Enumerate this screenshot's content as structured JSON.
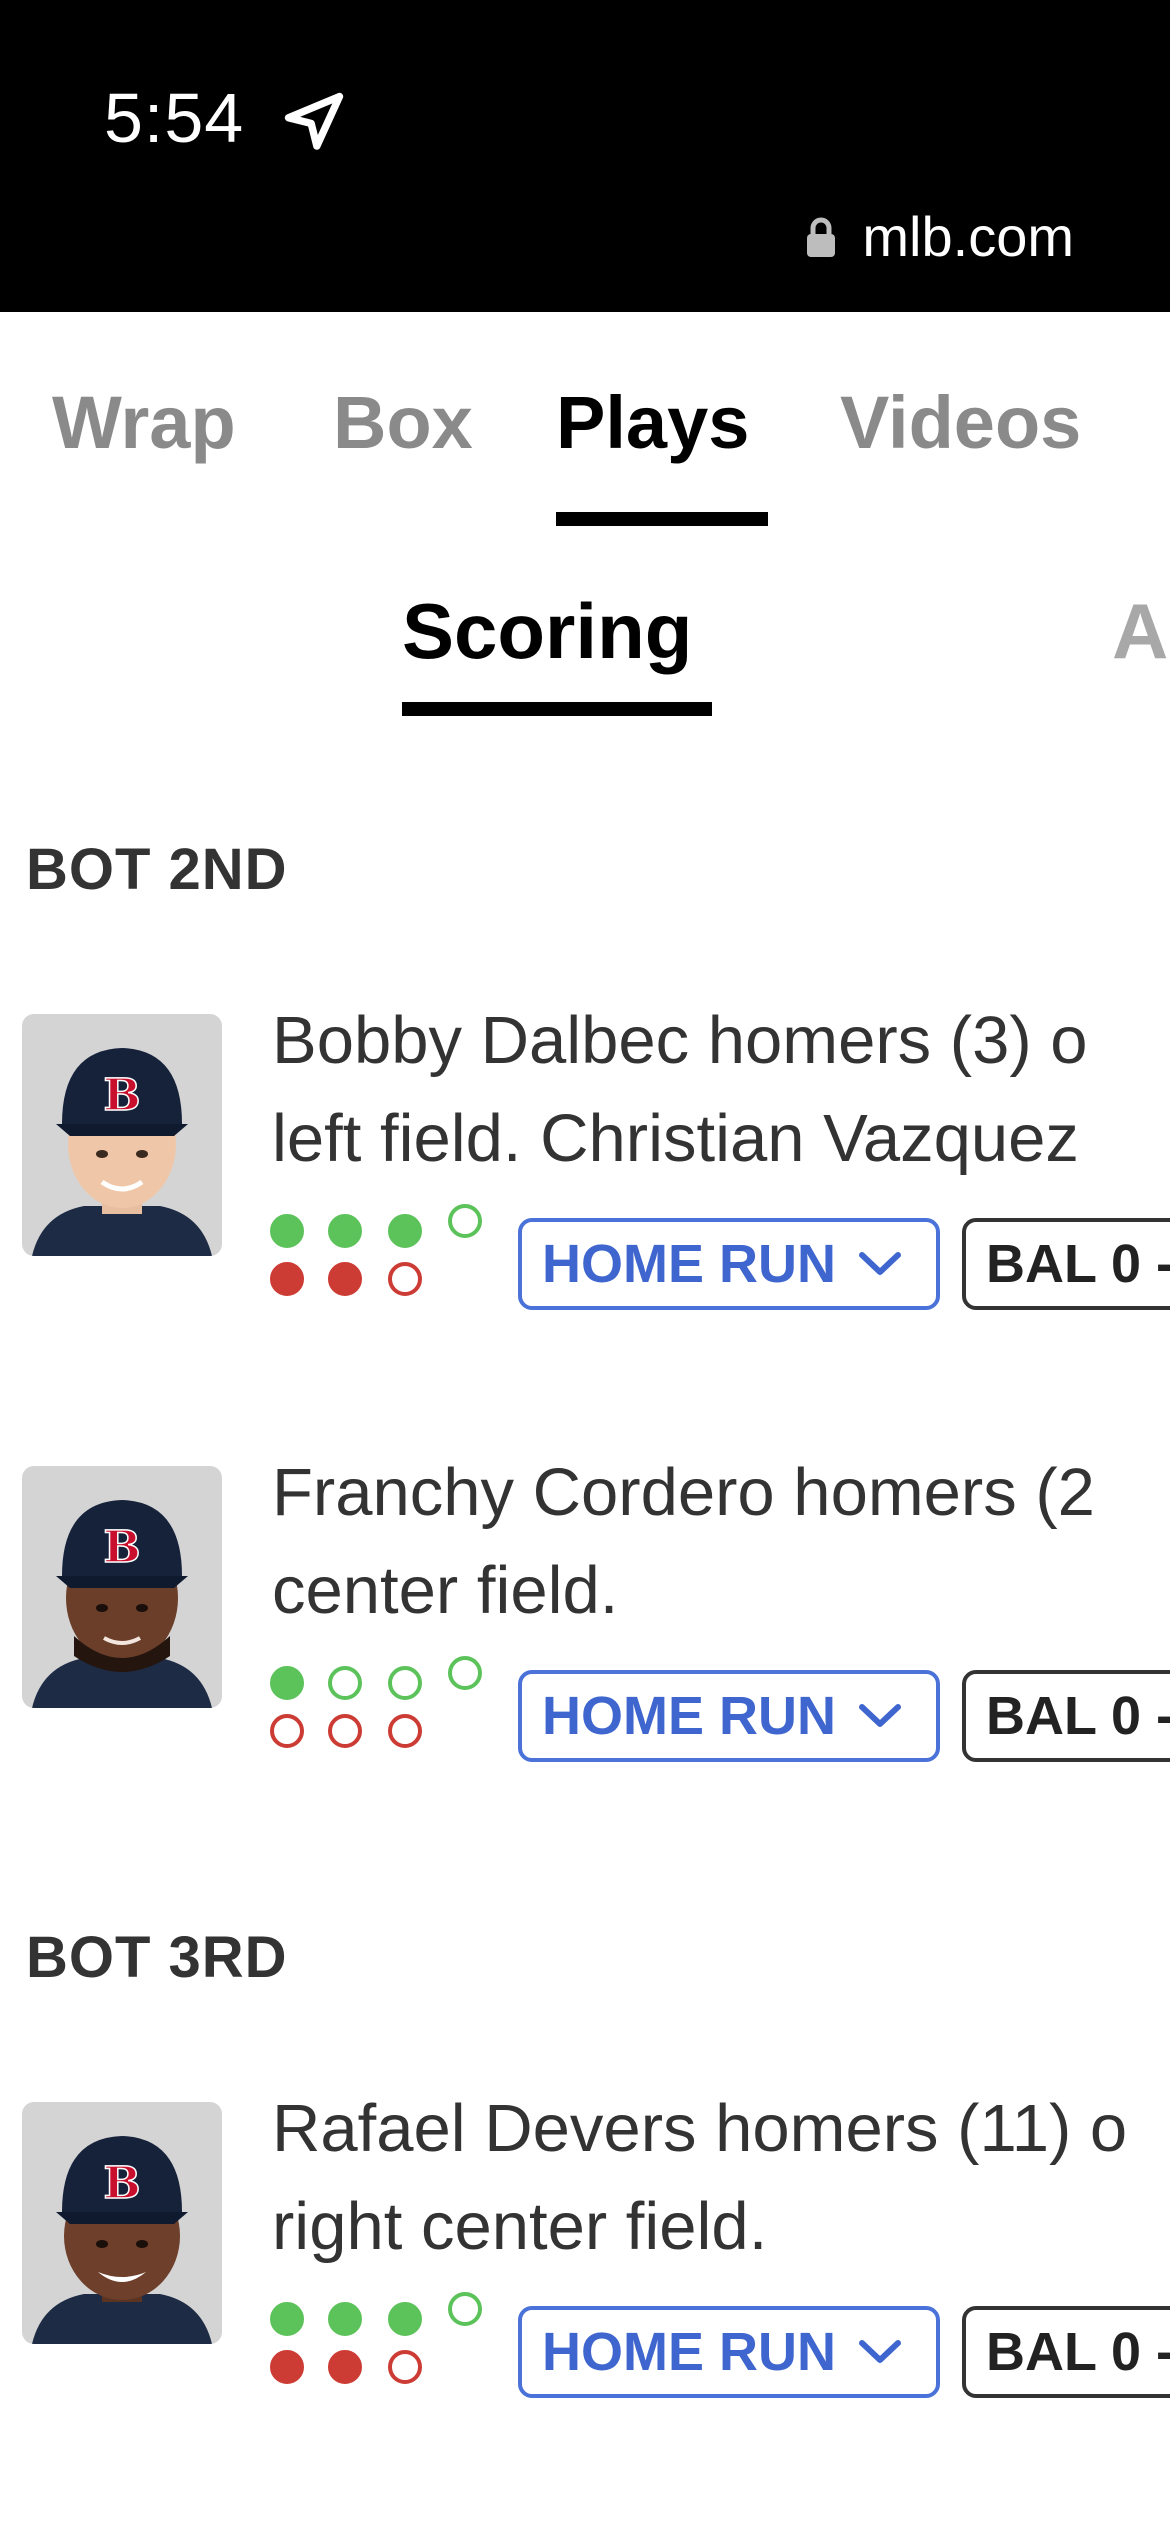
{
  "status_bar": {
    "time": "5:54",
    "url": "mlb.com"
  },
  "tabs": [
    {
      "label": "Wrap"
    },
    {
      "label": "Box"
    },
    {
      "label": "Plays"
    },
    {
      "label": "Videos"
    }
  ],
  "subtabs": [
    {
      "label": "Scoring"
    },
    {
      "label": "A"
    }
  ],
  "innings": [
    {
      "label": "BOT 2ND"
    },
    {
      "label": "BOT 3RD"
    }
  ],
  "plays": [
    {
      "line1": "Bobby Dalbec homers (3) o",
      "line2": "left field. Christian Vazquez",
      "play_type": "HOME RUN",
      "score": "BAL 0 -",
      "runners_on": 3,
      "outs": 2
    },
    {
      "line1": "Franchy Cordero homers (2",
      "line2": "center field.",
      "play_type": "HOME RUN",
      "score": "BAL 0 -",
      "runners_on": 1,
      "outs": 0
    },
    {
      "line1": "Rafael Devers homers (11) o",
      "line2": "right center field.",
      "play_type": "HOME RUN",
      "score": "BAL 0 -",
      "runners_on": 3,
      "outs": 2
    }
  ],
  "colors": {
    "green": "#5cc25a",
    "red": "#cc3b34",
    "blue": "#4a72d8"
  },
  "icons": [
    "location-arrow-icon",
    "lock-icon",
    "chevron-down-icon",
    "red-sox-b-logo-icon"
  ]
}
